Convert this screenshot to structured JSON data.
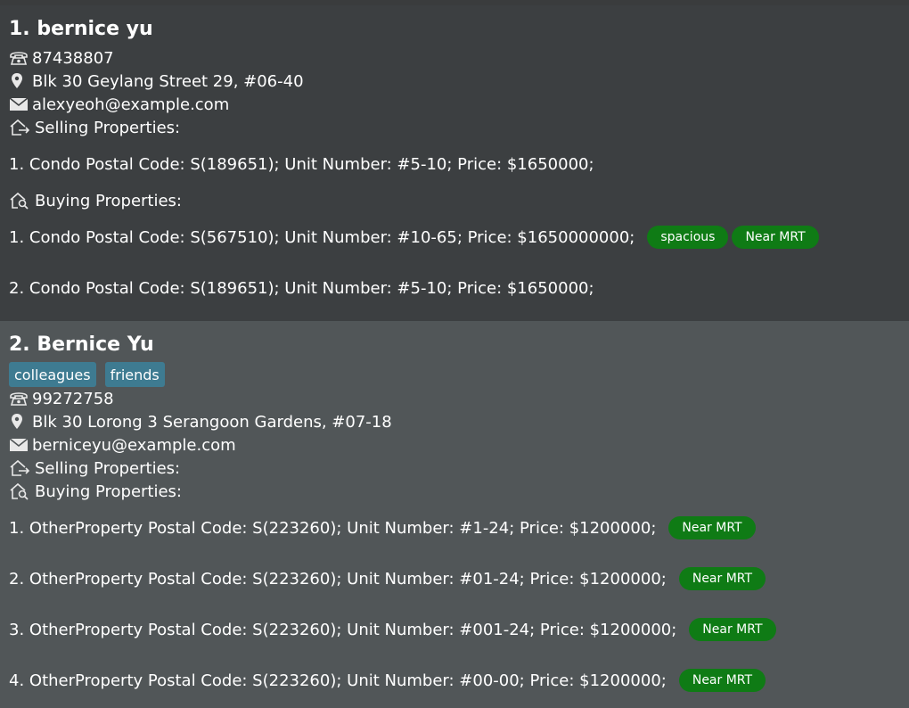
{
  "persons": [
    {
      "name": "1. bernice yu",
      "phone": "87438807",
      "address": "Blk 30 Geylang Street 29, #06-40",
      "email": "alexyeoh@example.com",
      "selling_header": "Selling Properties:",
      "selling": [
        {
          "text": "1. Condo Postal Code: S(189651);  Unit Number: #5-10;  Price: $1650000;",
          "tags": []
        }
      ],
      "buying_header": "Buying Properties:",
      "buying": [
        {
          "text": "1. Condo Postal Code: S(567510);  Unit Number: #10-65;  Price: $1650000000;",
          "tags": [
            "spacious",
            "Near MRT"
          ]
        },
        {
          "text": "2. Condo Postal Code: S(189651);  Unit Number: #5-10;  Price: $1650000;",
          "tags": []
        }
      ]
    },
    {
      "name": "2. Bernice Yu",
      "tags": [
        "colleagues",
        "friends"
      ],
      "phone": "99272758",
      "address": "Blk 30 Lorong 3 Serangoon Gardens, #07-18",
      "email": "berniceyu@example.com",
      "selling_header": "Selling Properties:",
      "selling": [],
      "buying_header": "Buying Properties:",
      "buying": [
        {
          "text": "1. OtherProperty Postal Code: S(223260);  Unit Number: #1-24;  Price: $1200000;",
          "tags": [
            "Near MRT"
          ]
        },
        {
          "text": "2. OtherProperty Postal Code: S(223260);  Unit Number: #01-24;  Price: $1200000;",
          "tags": [
            "Near MRT"
          ]
        },
        {
          "text": "3. OtherProperty Postal Code: S(223260);  Unit Number: #001-24;  Price: $1200000;",
          "tags": [
            "Near MRT"
          ]
        },
        {
          "text": "4. OtherProperty Postal Code: S(223260);  Unit Number: #00-00;  Price: $1200000;",
          "tags": [
            "Near MRT"
          ]
        }
      ]
    }
  ],
  "icons": {
    "phone": "phone-icon",
    "address": "location-pin-icon",
    "email": "email-icon",
    "selling": "house-arrow-out-icon",
    "buying": "house-search-icon"
  },
  "colors": {
    "card_1_bg": "#3c3f41",
    "card_2_bg": "#515658",
    "property_tag_bg": "#0f7b15",
    "person_tag_bg": "#3e7b91"
  }
}
